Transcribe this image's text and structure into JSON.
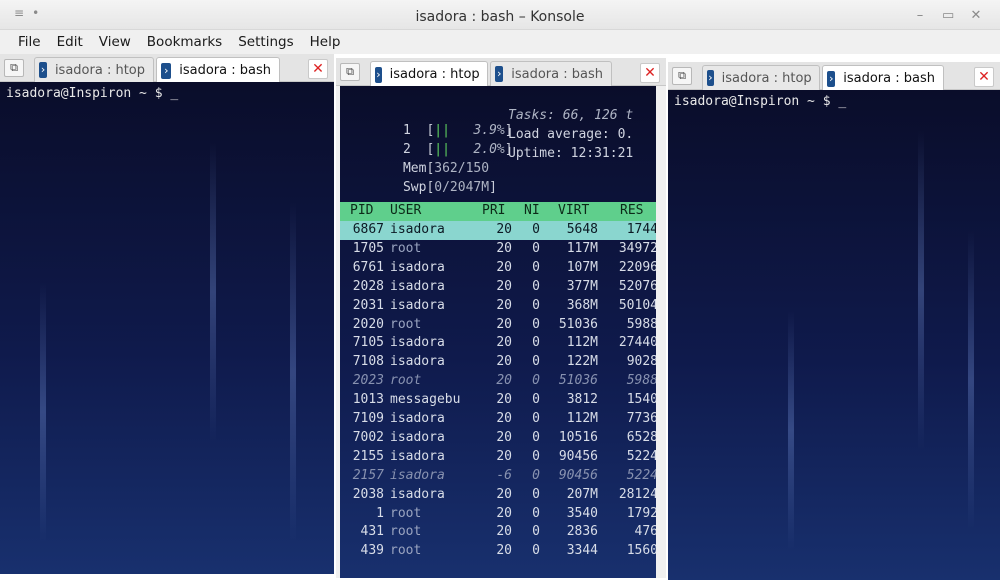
{
  "window": {
    "title": "isadora : bash – Konsole",
    "titlebar_left_icons": [
      "menu-icon",
      "pin-icon"
    ],
    "titlebar_right_icons": [
      "minimize-icon",
      "maximize-icon",
      "close-icon"
    ]
  },
  "menu": [
    "File",
    "Edit",
    "View",
    "Bookmarks",
    "Settings",
    "Help"
  ],
  "panes": [
    {
      "tabs": [
        {
          "label": "isadora : htop",
          "active": false
        },
        {
          "label": "isadora : bash",
          "active": true
        }
      ],
      "prompt": "isadora@Inspiron ~ $ _"
    },
    {
      "tabs": [
        {
          "label": "isadora : htop",
          "active": true
        },
        {
          "label": "isadora : bash",
          "active": false
        }
      ],
      "htop": {
        "meters": [
          {
            "label": "1",
            "bar": "||",
            "value": "3.9%"
          },
          {
            "label": "2",
            "bar": "||",
            "value": "2.0%"
          },
          {
            "label": "Mem",
            "value": "362/150"
          },
          {
            "label": "Swp",
            "value": "0/2047M"
          }
        ],
        "stats": {
          "tasks": "Tasks: 66, 126 t",
          "load": "Load average: 0.",
          "uptime": "Uptime: 12:31:21"
        },
        "columns": [
          "PID",
          "USER",
          "PRI",
          "NI",
          "VIRT",
          "RES"
        ],
        "rows": [
          {
            "pid": "6867",
            "user": "isadora",
            "pri": "20",
            "ni": "0",
            "virt": "5648",
            "res": "1744"
          },
          {
            "pid": "1705",
            "user": "root",
            "pri": "20",
            "ni": "0",
            "virt": "117M",
            "res": "34972"
          },
          {
            "pid": "6761",
            "user": "isadora",
            "pri": "20",
            "ni": "0",
            "virt": "107M",
            "res": "22096"
          },
          {
            "pid": "2028",
            "user": "isadora",
            "pri": "20",
            "ni": "0",
            "virt": "377M",
            "res": "52076"
          },
          {
            "pid": "2031",
            "user": "isadora",
            "pri": "20",
            "ni": "0",
            "virt": "368M",
            "res": "50104"
          },
          {
            "pid": "2020",
            "user": "root",
            "pri": "20",
            "ni": "0",
            "virt": "51036",
            "res": "5988"
          },
          {
            "pid": "7105",
            "user": "isadora",
            "pri": "20",
            "ni": "0",
            "virt": "112M",
            "res": "27440"
          },
          {
            "pid": "7108",
            "user": "isadora",
            "pri": "20",
            "ni": "0",
            "virt": "122M",
            "res": "9028"
          },
          {
            "pid": "2023",
            "user": "root",
            "pri": "20",
            "ni": "0",
            "virt": "51036",
            "res": "5988"
          },
          {
            "pid": "1013",
            "user": "messagebu",
            "pri": "20",
            "ni": "0",
            "virt": "3812",
            "res": "1540"
          },
          {
            "pid": "7109",
            "user": "isadora",
            "pri": "20",
            "ni": "0",
            "virt": "112M",
            "res": "7736"
          },
          {
            "pid": "7002",
            "user": "isadora",
            "pri": "20",
            "ni": "0",
            "virt": "10516",
            "res": "6528"
          },
          {
            "pid": "2155",
            "user": "isadora",
            "pri": "20",
            "ni": "0",
            "virt": "90456",
            "res": "5224"
          },
          {
            "pid": "2157",
            "user": "isadora",
            "pri": "-6",
            "ni": "0",
            "virt": "90456",
            "res": "5224"
          },
          {
            "pid": "2038",
            "user": "isadora",
            "pri": "20",
            "ni": "0",
            "virt": "207M",
            "res": "28124"
          },
          {
            "pid": "1",
            "user": "root",
            "pri": "20",
            "ni": "0",
            "virt": "3540",
            "res": "1792"
          },
          {
            "pid": "431",
            "user": "root",
            "pri": "20",
            "ni": "0",
            "virt": "2836",
            "res": "476"
          },
          {
            "pid": "439",
            "user": "root",
            "pri": "20",
            "ni": "0",
            "virt": "3344",
            "res": "1560"
          }
        ]
      }
    },
    {
      "tabs": [
        {
          "label": "isadora : htop",
          "active": false
        },
        {
          "label": "isadora : bash",
          "active": true
        }
      ],
      "prompt": "isadora@Inspiron ~ $ _"
    }
  ]
}
